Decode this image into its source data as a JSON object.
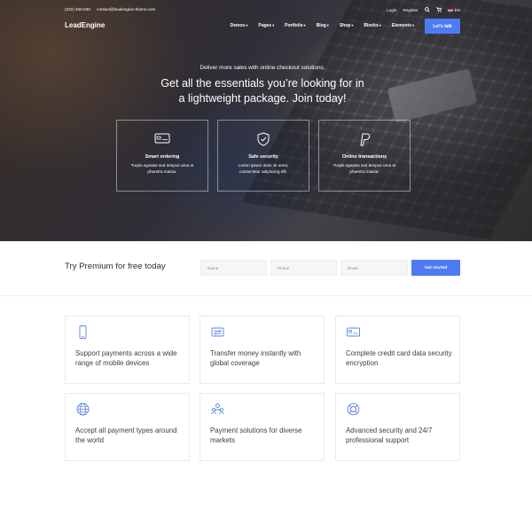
{
  "topbar": {
    "phone": "(222) 400-630",
    "email": "contact@leadengine-theme.com",
    "login": "Login",
    "register": "Register",
    "search_icon": "search-icon",
    "cart_icon": "cart-icon",
    "language": "EN"
  },
  "nav": {
    "logo": "LeadEngine",
    "items": [
      {
        "label": "Demos"
      },
      {
        "label": "Pages"
      },
      {
        "label": "Portfolio"
      },
      {
        "label": "Blog"
      },
      {
        "label": "Shop"
      },
      {
        "label": "Blocks"
      },
      {
        "label": "Elements"
      }
    ],
    "cta": "Let's talk"
  },
  "hero": {
    "subtitle": "Deliver more sales with online checkout solutions.",
    "title_line1": "Get all the essentials you’re looking for in",
    "title_line2": "a lightweight package. Join today!",
    "features": [
      {
        "icon": "credit-card-icon",
        "title": "Smart ordering",
        "desc": "Turpis egestas sed tempus urna et pharetra massa."
      },
      {
        "icon": "shield-icon",
        "title": "Safe security",
        "desc": "Lorem ipsum dolor sit amet, consectetur adipiscing elit."
      },
      {
        "icon": "paypal-icon",
        "title": "Online transactions",
        "desc": "Turpis egestas sed tempus urna et pharetra massa."
      }
    ]
  },
  "signup": {
    "title": "Try Premium for free today",
    "name_placeholder": "Name",
    "phone_placeholder": "Phone",
    "email_placeholder": "Email",
    "button": "Get started"
  },
  "services": [
    {
      "icon": "mobile-icon",
      "text": "Support payments across a wide range of mobile devices"
    },
    {
      "icon": "money-transfer-icon",
      "text": "Transfer money instantly with global coverage"
    },
    {
      "icon": "credit-card-icon",
      "text": "Complete credit card data security encryption"
    },
    {
      "icon": "globe-icon",
      "text": "Accept all payment types around the world"
    },
    {
      "icon": "users-icon",
      "text": "Payment solutions for diverse markets"
    },
    {
      "icon": "support-lifebuoy-icon",
      "text": "Advanced security and 24/7 professional support"
    }
  ],
  "colors": {
    "accent": "#4e7bf2",
    "icon_blue": "#5b7fe6",
    "text_dark": "#2b2f3a"
  }
}
